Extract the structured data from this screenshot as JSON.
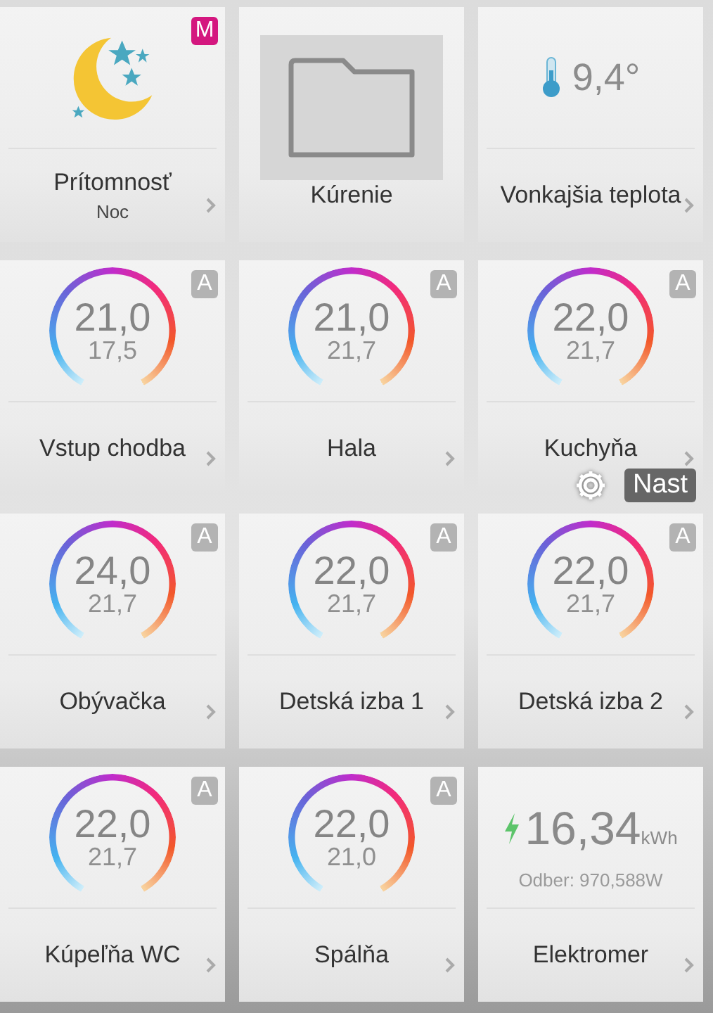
{
  "tiles": [
    {
      "kind": "presence",
      "label": "Prítomnosť",
      "sublabel": "Noc",
      "badge": {
        "text": "M",
        "color": "#d4177f"
      },
      "chevron": true
    },
    {
      "kind": "folder",
      "label": "Kúrenie",
      "chevron": false
    },
    {
      "kind": "temperature",
      "label": "Vonkajšia teplota",
      "value": "9,4°",
      "chevron": true
    },
    {
      "kind": "thermostat",
      "label": "Vstup chodba",
      "setpoint": "21,0",
      "actual": "17,5",
      "badge": {
        "text": "A",
        "color": "#b3b3b3"
      },
      "chevron": true
    },
    {
      "kind": "thermostat",
      "label": "Hala",
      "setpoint": "21,0",
      "actual": "21,7",
      "badge": {
        "text": "A",
        "color": "#b3b3b3"
      },
      "chevron": true
    },
    {
      "kind": "thermostat",
      "label": "Kuchyňa",
      "setpoint": "22,0",
      "actual": "21,7",
      "badge": {
        "text": "A",
        "color": "#b3b3b3"
      },
      "chevron": true
    },
    {
      "kind": "thermostat",
      "label": "Obývačka",
      "setpoint": "24,0",
      "actual": "21,7",
      "badge": {
        "text": "A",
        "color": "#b3b3b3"
      },
      "chevron": true
    },
    {
      "kind": "thermostat",
      "label": "Detská izba 1",
      "setpoint": "22,0",
      "actual": "21,7",
      "badge": {
        "text": "A",
        "color": "#b3b3b3"
      },
      "chevron": true
    },
    {
      "kind": "thermostat",
      "label": "Detská izba 2",
      "setpoint": "22,0",
      "actual": "21,7",
      "badge": {
        "text": "A",
        "color": "#b3b3b3"
      },
      "chevron": true
    },
    {
      "kind": "thermostat",
      "label": "Kúpeľňa WC",
      "setpoint": "22,0",
      "actual": "21,7",
      "badge": {
        "text": "A",
        "color": "#b3b3b3"
      },
      "chevron": true
    },
    {
      "kind": "thermostat",
      "label": "Spálňa",
      "setpoint": "22,0",
      "actual": "21,0",
      "badge": {
        "text": "A",
        "color": "#b3b3b3"
      },
      "chevron": true
    },
    {
      "kind": "meter",
      "label": "Elektromer",
      "value": "16,34",
      "unit": "kWh",
      "detail": "Odber: 970,588W",
      "chevron": true
    }
  ],
  "overlay": {
    "label": "Nast"
  }
}
